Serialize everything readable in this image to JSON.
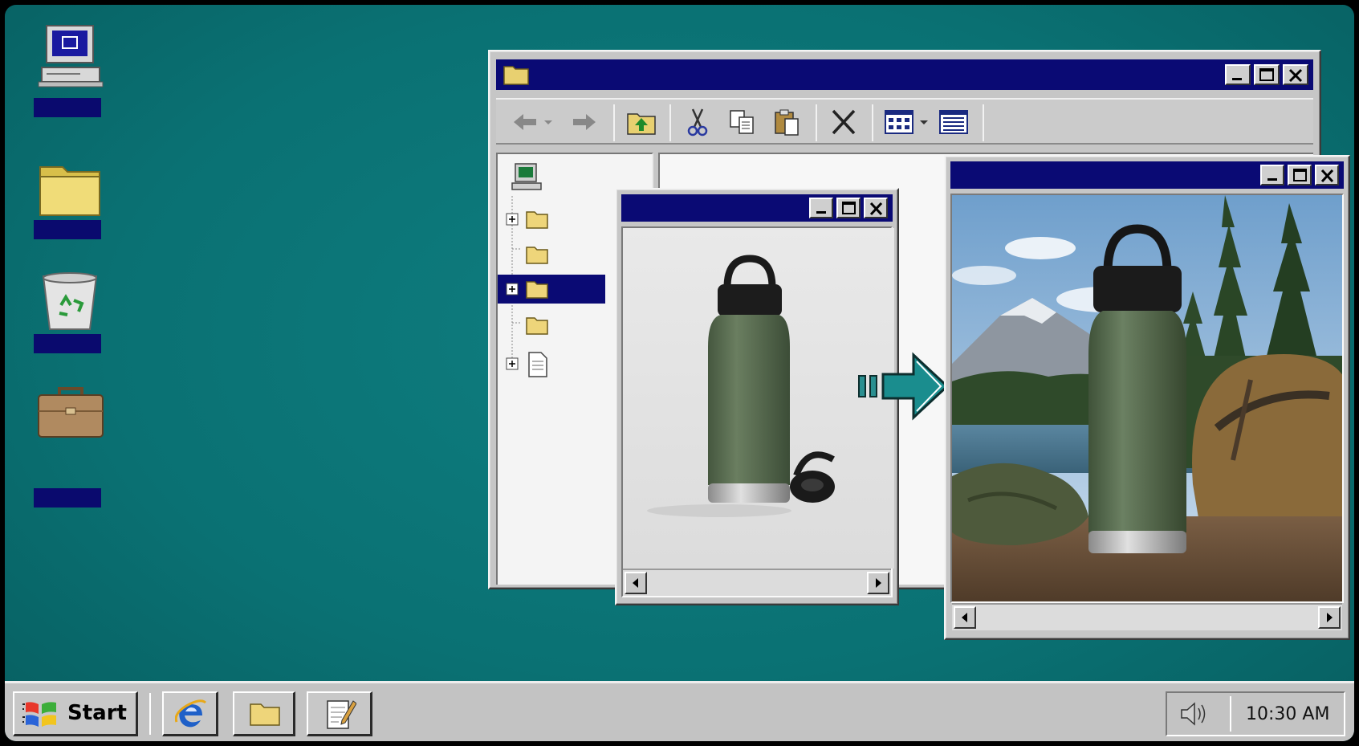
{
  "desktop": {
    "icons": [
      {
        "name": "my-computer",
        "label": ""
      },
      {
        "name": "folder",
        "label": ""
      },
      {
        "name": "recycle-bin",
        "label": ""
      },
      {
        "name": "briefcase",
        "label": ""
      }
    ]
  },
  "explorer": {
    "title": "",
    "toolbar": [
      "back-icon",
      "forward-icon",
      "up-folder-icon",
      "cut-icon",
      "copy-icon",
      "paste-icon",
      "delete-icon",
      "view-icon",
      "details-icon"
    ],
    "tree_items": [
      "computer",
      "folder",
      "folder",
      "folder-selected",
      "folder",
      "document"
    ]
  },
  "preview_before": {
    "title": "",
    "image": "bottle-on-white-background"
  },
  "preview_after": {
    "title": "",
    "image": "bottle-in-outdoor-scene"
  },
  "taskbar": {
    "start_label": "Start",
    "quicklaunch": [
      "internet-explorer-icon",
      "folder-icon",
      "notepad-icon"
    ],
    "clock": "10:30 AM"
  },
  "colors": {
    "desktop": "#0a7173",
    "titlebar": "#0a0a74",
    "chrome": "#c6c6c6",
    "bottle": "#5a6e52"
  }
}
